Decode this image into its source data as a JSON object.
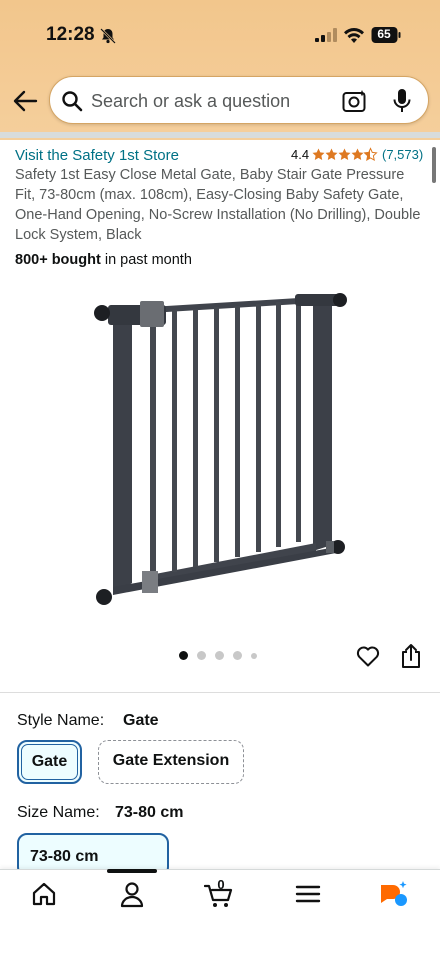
{
  "status_bar": {
    "time": "12:28",
    "battery": "65"
  },
  "search": {
    "placeholder": "Search or ask a question"
  },
  "product": {
    "store_link": "Visit the Safety 1st Store",
    "rating": "4.4",
    "rating_stars": 4.4,
    "rating_count": "(7,573)",
    "title": "Safety 1st Easy Close Metal Gate, Baby Stair Gate Pressure Fit, 73-80cm (max. 108cm), Easy-Closing Baby Safety Gate, One-Hand Opening, No-Screw Installation (No Drilling), Double Lock System, Black",
    "bought_bold": "800+ bought",
    "bought_rest": " in past month",
    "image_icon": "baby-gate-product-image",
    "carousel_count": 5,
    "carousel_active": 1
  },
  "variations": {
    "style_label": "Style Name:",
    "style_value": "Gate",
    "style_options": [
      "Gate",
      "Gate Extension"
    ],
    "size_label": "Size Name:",
    "size_value": "73-80 cm",
    "size_options": [
      "73-80 cm"
    ]
  },
  "bottom_nav": {
    "items": [
      "home-icon",
      "account-icon",
      "cart-icon",
      "menu-icon",
      "rufus-icon"
    ],
    "cart_count": "0"
  },
  "colors": {
    "header": "#f2c68c",
    "link": "#007185",
    "star": "#de7921",
    "selected_border": "#2162a1"
  }
}
